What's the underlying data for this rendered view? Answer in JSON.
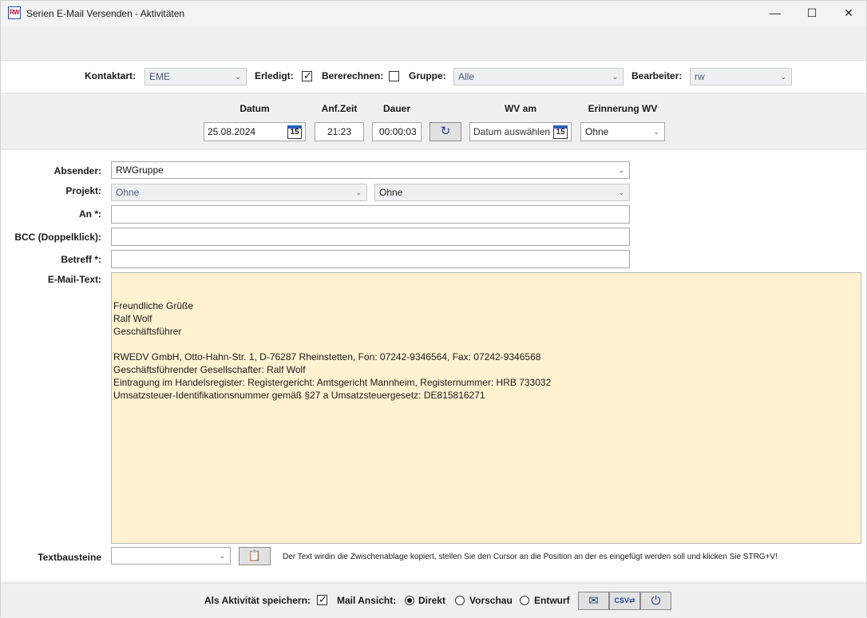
{
  "window": {
    "title": "Serien E-Mail Versenden - Aktivitäten",
    "app_icon_text": "RW",
    "minimize_glyph": "—",
    "maximize_glyph": "☐",
    "close_glyph": "✕"
  },
  "filters": {
    "kontaktart_label": "Kontaktart:",
    "kontaktart_value": "EME",
    "erledigt_label": "Erledigt:",
    "erledigt_checked": true,
    "bererechnen_label": "Bererechnen:",
    "bererechnen_checked": false,
    "gruppe_label": "Gruppe:",
    "gruppe_value": "Alle",
    "bearbeiter_label": "Bearbeiter:",
    "bearbeiter_value": "rw"
  },
  "dates": {
    "datum_label": "Datum",
    "datum_value": "25.08.2024",
    "anfzeit_label": "Anf.Zeit",
    "anfzeit_value": "21:23",
    "dauer_label": "Dauer",
    "dauer_value": "00:00:03",
    "wv_label": "WV am",
    "wv_value": "Datum auswählen",
    "erinnerung_label": "Erinnerung WV",
    "erinnerung_value": "Ohne",
    "calendar_day": "15"
  },
  "form": {
    "absender_label": "Absender:",
    "absender_value": "RWGruppe",
    "projekt_label": "Projekt:",
    "projekt_value_1": "Ohne",
    "projekt_value_2": "Ohne",
    "an_label": "An *:",
    "bcc_label": "BCC (Doppelklick):",
    "betreff_label": "Betreff *:",
    "mailtext_label": "E-Mail-Text:",
    "mail_lines": [
      "Freundliche Grüße",
      "Ralf Wolf",
      "Geschäftsführer",
      "",
      "RWEDV GmbH, Otto-Hahn-Str. 1, D-76287 Rheinstetten, Fon: 07242-9346564, Fax: 07242-9346568",
      "Geschäftsführender Gesellschafter: Ralf Wolf",
      "Eintragung im Handelsregister: Registergericht: Amtsgericht Mannheim, Registernummer: HRB 733032",
      "Umsatzsteuer-Identifikationsnummer gemäß §27 a Umsatzsteuergesetz: DE815816271"
    ],
    "textbausteine_label": "Textbausteine",
    "textbausteine_value": "",
    "hint": "Der Text wirdin die Zwischenablage kopiert, stellen Sie den Cursor an die Position an der es eingefügt werden soll und klicken Sie STRG+V!"
  },
  "bottom": {
    "als_aktivitaet_label": "Als Aktivität speichern:",
    "als_aktivitaet_checked": true,
    "mail_ansicht_label": "Mail Ansicht:",
    "opt_direkt": "Direkt",
    "opt_vorschau": "Vorschau",
    "opt_entwurf": "Entwurf",
    "selected_view": "Direkt",
    "send_icon_glyph": "✉",
    "csv_icon_text": "CSV⇄",
    "power_icon_glyph": "⏻"
  }
}
